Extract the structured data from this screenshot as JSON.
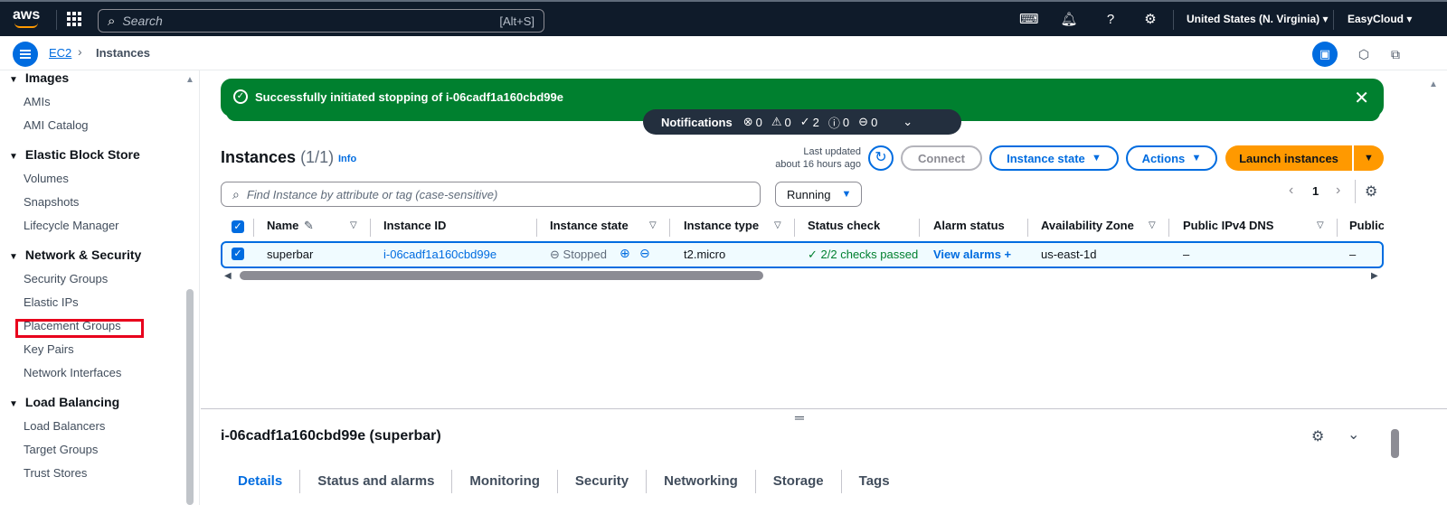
{
  "topnav": {
    "logo": "aws",
    "search_placeholder": "Search",
    "search_shortcut": "[Alt+S]",
    "region": "United States (N. Virginia) ▾",
    "account": "EasyCloud ▾"
  },
  "breadcrumb": {
    "root": "EC2",
    "current": "Instances"
  },
  "sidebar": {
    "sections": [
      {
        "title": "Images",
        "items": [
          "AMIs",
          "AMI Catalog"
        ]
      },
      {
        "title": "Elastic Block Store",
        "items": [
          "Volumes",
          "Snapshots",
          "Lifecycle Manager"
        ]
      },
      {
        "title": "Network & Security",
        "items": [
          "Security Groups",
          "Elastic IPs",
          "Placement Groups",
          "Key Pairs",
          "Network Interfaces"
        ]
      },
      {
        "title": "Load Balancing",
        "items": [
          "Load Balancers",
          "Target Groups",
          "Trust Stores"
        ]
      }
    ]
  },
  "flash": {
    "message": "Successfully initiated stopping of i-06cadf1a160cbd99e"
  },
  "notifications": {
    "title": "Notifications",
    "counts": [
      {
        "icon": "error-icon",
        "glyph": "⊗",
        "value": "0"
      },
      {
        "icon": "warning-icon",
        "glyph": "⚠",
        "value": "0"
      },
      {
        "icon": "success-icon",
        "glyph": "✓",
        "value": "2"
      },
      {
        "icon": "info-icon",
        "glyph": "ⓘ",
        "value": "0"
      },
      {
        "icon": "pending-icon",
        "glyph": "⊖",
        "value": "0"
      }
    ]
  },
  "instances": {
    "title": "Instances",
    "count": "(1/1)",
    "info": "Info",
    "last_updated_1": "Last updated",
    "last_updated_2": "about 16 hours ago",
    "connect": "Connect",
    "instance_state": "Instance state",
    "actions": "Actions",
    "launch": "Launch instances",
    "filter_placeholder": "Find Instance by attribute or tag (case-sensitive)",
    "filter_value": "Running",
    "page": "1"
  },
  "table": {
    "headers": [
      "Name",
      "Instance ID",
      "Instance state",
      "Instance type",
      "Status check",
      "Alarm status",
      "Availability Zone",
      "Public IPv4 DNS",
      "Public"
    ],
    "row": {
      "name": "superbar",
      "instance_id": "i-06cadf1a160cbd99e",
      "state": "Stopped",
      "type": "t2.micro",
      "status_check": "2/2 checks passed",
      "alarm": "View alarms",
      "az": "us-east-1d",
      "dns": "–",
      "public": "–"
    }
  },
  "details": {
    "title": "i-06cadf1a160cbd99e (superbar)",
    "tabs": [
      "Details",
      "Status and alarms",
      "Monitoring",
      "Security",
      "Networking",
      "Storage",
      "Tags"
    ]
  },
  "colors": {
    "primary": "#006ce0",
    "success": "#00802f",
    "launch": "#ff9900",
    "nav": "#0f1b2a",
    "highlight": "#e8001c"
  }
}
